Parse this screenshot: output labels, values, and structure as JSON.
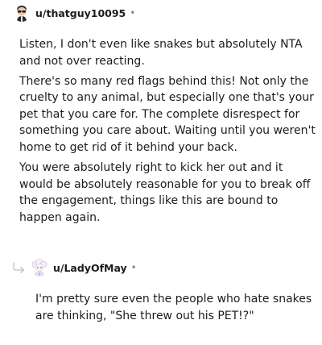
{
  "comment1": {
    "username": "u/thatguy10095",
    "separator": "•",
    "avatar_icon": "snoo-avatar-sunglasses-icon",
    "paragraphs": [
      "Listen, I don't even like snakes but absolutely NTA and not over reacting.",
      "There's so many red flags behind this! Not only the cruelty to any animal, but especially one that's your pet that you care for. The complete disrespect for something you care about. Waiting until you weren't home to get rid of it behind your back.",
      "You were absolutely right to kick her out and it would be absolutely reasonable for you to break off the engagement, things like this are bound to happen again."
    ]
  },
  "comment2": {
    "username": "u/LadyOfMay",
    "separator": "•",
    "avatar_icon": "snoo-avatar-white-hair-icon",
    "reply_icon": "reply-arrow-icon",
    "paragraphs": [
      "I'm pretty sure even the people who hate snakes are thinking, \"She threw out his PET!?\""
    ]
  },
  "colors": {
    "text": "#1c1c1c",
    "meta": "#878a8c",
    "background": "#ffffff"
  }
}
